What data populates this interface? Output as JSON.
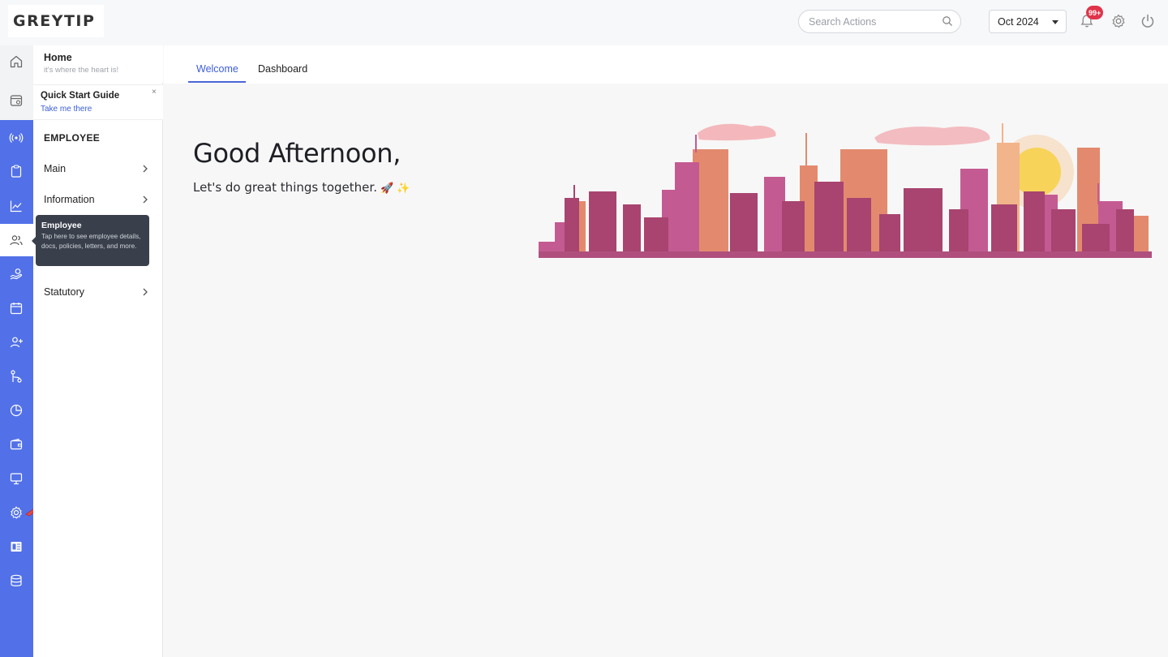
{
  "brand": {
    "logo_text": "GREYTIP"
  },
  "header": {
    "search": {
      "placeholder": "Search Actions",
      "icon": "search-icon"
    },
    "period": {
      "value": "Oct 2024"
    },
    "notifications": {
      "badge": "99+",
      "icon": "bell-icon"
    },
    "settings_icon": "gear-icon",
    "power_icon": "power-icon"
  },
  "rail": {
    "icons": [
      "home-icon",
      "guide-icon",
      "broadcast-icon",
      "clipboard-icon",
      "chart-icon",
      "employee-icon",
      "payroll-icon",
      "calendar-icon",
      "add-user-icon",
      "workflow-icon",
      "pie-chart-icon",
      "wallet-icon",
      "monitor-icon",
      "settings-icon",
      "document-icon",
      "database-icon"
    ],
    "active": "employee-icon",
    "colors": {
      "rail_bg": "#5271e8"
    }
  },
  "sidebar": {
    "home": {
      "title": "Home",
      "subtitle": "it's where the heart is!"
    },
    "guide": {
      "title": "Quick Start Guide",
      "link": "Take me there",
      "close": "×"
    },
    "section_title": "EMPLOYEE",
    "items": [
      {
        "label": "Main"
      },
      {
        "label": "Information"
      },
      {
        "label": "Statutory"
      }
    ]
  },
  "tooltip": {
    "title": "Employee",
    "text": "Tap here to see employee details, docs, policies, letters, and more."
  },
  "tabs": [
    {
      "label": "Welcome",
      "active": true
    },
    {
      "label": "Dashboard",
      "active": false
    }
  ],
  "main": {
    "greeting": "Good Afternoon,",
    "tagline": "Let's do great things together.",
    "tagline_emoji": "🚀 ✨"
  },
  "colors": {
    "accent": "#3b5ed8",
    "badge": "#e0344a",
    "tooltip_bg": "#3a404b"
  }
}
